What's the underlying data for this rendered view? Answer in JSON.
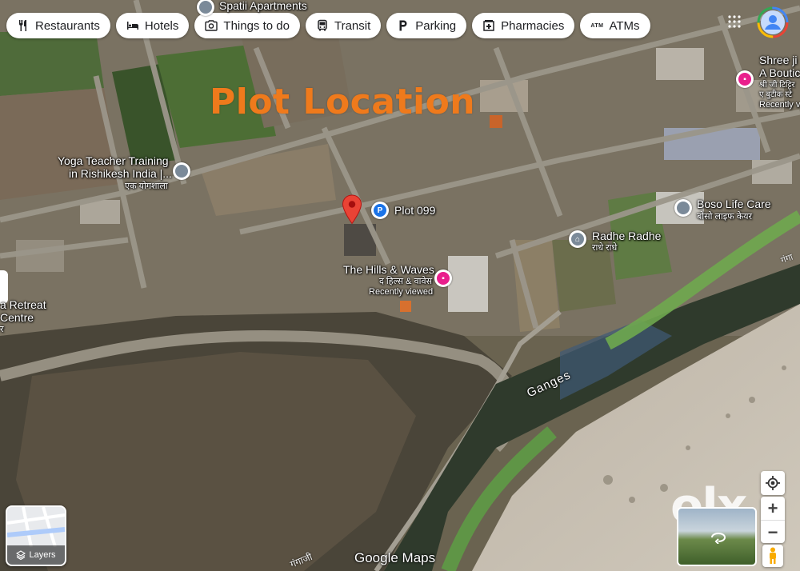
{
  "filters": [
    {
      "label": "Restaurants",
      "icon": "fork-knife-icon"
    },
    {
      "label": "Hotels",
      "icon": "bed-icon"
    },
    {
      "label": "Things to do",
      "icon": "camera-icon"
    },
    {
      "label": "Transit",
      "icon": "bus-icon"
    },
    {
      "label": "Parking",
      "icon": "parking-icon"
    },
    {
      "label": "Pharmacies",
      "icon": "pharmacy-icon"
    },
    {
      "label": "ATMs",
      "icon": "atm-icon"
    }
  ],
  "overlay_title": "Plot Location",
  "places": {
    "spatii": "Spatii Apartments",
    "yoga_teacher_1": "Yoga Teacher Training",
    "yoga_teacher_2": "in Rishikesh India |...",
    "yoga_teacher_3": "एक योगशाला",
    "plot": "Plot 099",
    "hills_1": "The Hills & Waves",
    "hills_2": "द हिल्स & वावेस",
    "hills_3": "Recently viewed",
    "boso_1": "Boso Life Care",
    "boso_2": "बोसो लाइफ केयर",
    "radhe_1": "Radhe Radhe",
    "radhe_2": "राधे राधे",
    "shree_1": "Shree ji",
    "shree_2": "A Boutic",
    "shree_3": "श्री जी टिट्टिर",
    "shree_4": "ए बुटीक स्टे",
    "shree_5": "Recently v",
    "yoga_retreat_1": "a Retreat",
    "yoga_retreat_2": "Centre",
    "yoga_retreat_3": "र"
  },
  "river_label": "Ganges",
  "road_label_1": "गंगाजी",
  "road_label_2": "गंगा",
  "layers_label": "Layers",
  "zoom_in": "+",
  "zoom_out": "−",
  "google_logo": "Google Maps",
  "watermark": "olx",
  "colors": {
    "plot_title": "#ef7a1c",
    "marker_red": "#ea4335",
    "place_blue": "#1a73e8",
    "shopping_pink": "#e91e8c",
    "place_gray": "#7b8a99"
  }
}
